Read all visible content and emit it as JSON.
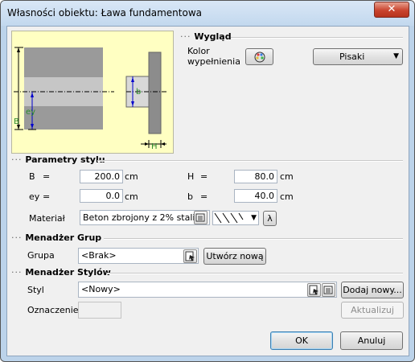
{
  "window": {
    "title": "Własności obiektu: Ława fundamentowa",
    "close_glyph": "✕"
  },
  "preview": {
    "label_ey": "ey",
    "label_b_upper": "B",
    "label_b_lower": "b",
    "label_h": "H"
  },
  "wyglad": {
    "title": "Wygląd",
    "color_label_line1": "Kolor",
    "color_label_line2": "wypełnienia",
    "pens_label": "Pisaki"
  },
  "parametry": {
    "title": "Parametry stylu",
    "B": {
      "label": "B",
      "eq": "=",
      "value": "200.0",
      "unit": "cm"
    },
    "H": {
      "label": "H",
      "eq": "=",
      "value": "80.0",
      "unit": "cm"
    },
    "ey": {
      "label": "ey",
      "eq": "=",
      "value": "0.0",
      "unit": "cm"
    },
    "b": {
      "label": "b",
      "eq": "=",
      "value": "40.0",
      "unit": "cm"
    },
    "material_label": "Materiał",
    "material_value": "Beton zbrojony z 2% stali",
    "lambda": "λ"
  },
  "grupy": {
    "title": "Menadżer Grup",
    "group_label": "Grupa",
    "group_value": "<Brak>",
    "create_button": "Utwórz nową"
  },
  "style": {
    "title": "Menadżer Stylów",
    "style_label": "Styl",
    "style_value": "<Nowy>",
    "add_button": "Dodaj nowy...",
    "mark_label": "Oznaczenie",
    "mark_value": "",
    "update_button": "Aktualizuj"
  },
  "footer": {
    "ok": "OK",
    "cancel": "Anuluj"
  },
  "colors": {
    "preview_bg": "#ffffc2",
    "window_frame": "#bcd3ea",
    "close_red": "#c9442e"
  }
}
